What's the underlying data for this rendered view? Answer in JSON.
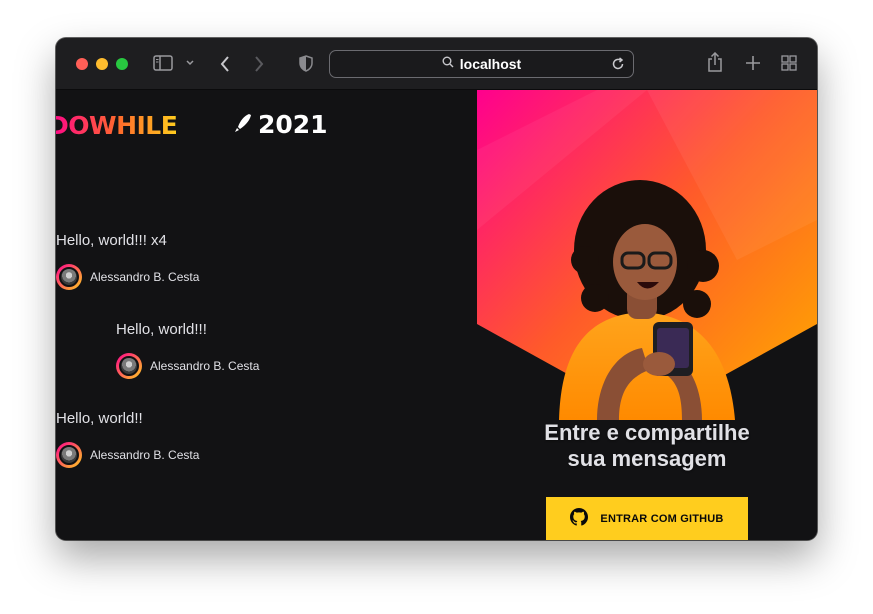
{
  "browser": {
    "url": "localhost",
    "icons": [
      "sidebar-icon",
      "chevron-down-icon",
      "back-icon",
      "forward-icon",
      "shield-icon",
      "search-icon",
      "reload-icon",
      "share-icon",
      "new-tab-icon",
      "tab-overview-icon"
    ]
  },
  "logo": {
    "brand": "DOWHILE",
    "year": "2021"
  },
  "messages": [
    {
      "text": "Hello, world!!! x4",
      "author": "Alessandro B. Cesta"
    },
    {
      "text": "Hello, world!!!",
      "author": "Alessandro B. Cesta"
    },
    {
      "text": "Hello, world!!",
      "author": "Alessandro B. Cesta"
    }
  ],
  "banner": {
    "title_line1": "Entre e compartilhe",
    "title_line2": "sua mensagem",
    "button_label": "ENTRAR COM GITHUB",
    "button_icon": "github-icon"
  },
  "colors": {
    "background": "#121214",
    "accent_yellow": "#ffcd1e",
    "gradient_pink": "#ff008e",
    "gradient_orange": "#ff8a00",
    "text": "#e1e1e6"
  }
}
